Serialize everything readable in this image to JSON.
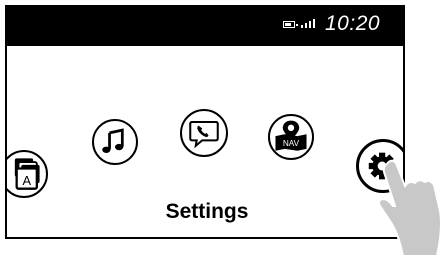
{
  "status_bar": {
    "clock": "10:20",
    "battery_icon": "battery-icon",
    "signal_icon": "signal-bars-icon"
  },
  "apps": [
    {
      "name": "apps",
      "icon": "apps-stack-icon",
      "letter": "A"
    },
    {
      "name": "music",
      "icon": "music-note-icon"
    },
    {
      "name": "phone",
      "icon": "phone-message-icon"
    },
    {
      "name": "navigation",
      "icon": "nav-map-icon",
      "text": "NAV"
    },
    {
      "name": "settings",
      "icon": "gear-icon"
    }
  ],
  "focused_label": "Settings",
  "colors": {
    "status_bar": "#000000",
    "hand": "#c8c8c8"
  }
}
